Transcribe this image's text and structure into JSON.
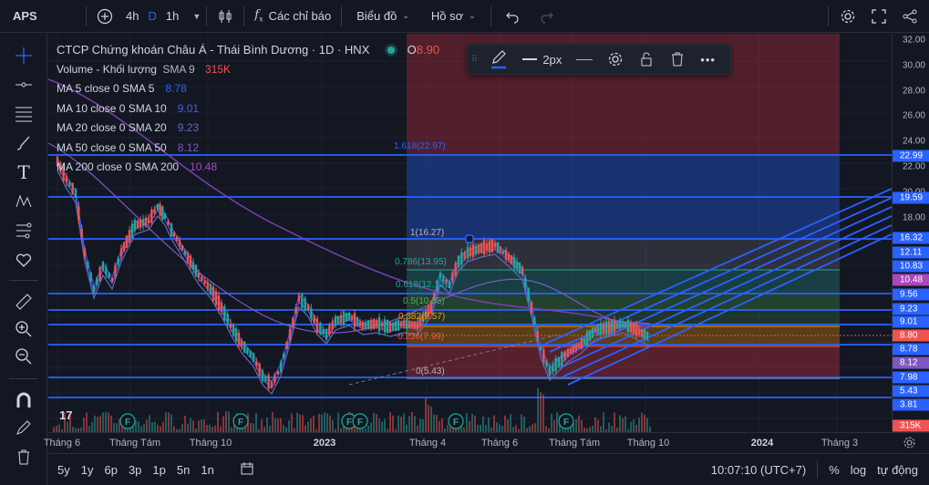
{
  "topbar": {
    "symbol": "APS",
    "timeframes": [
      "4h",
      "D",
      "1h"
    ],
    "active_timeframe": "D",
    "indicators_label": "Các chỉ báo",
    "chart_label": "Biểu đồ",
    "profile_label": "Hồ sơ"
  },
  "legend": {
    "title": "CTCP Chứng khoán Châu Á - Thái Bình Dương · 1D · HNX",
    "open_label": "O",
    "open_value": "8.90",
    "volume": {
      "label": "Volume - Khối lượng",
      "param": "SMA 9",
      "value": "315K",
      "color": "#ef5350"
    },
    "mas": [
      {
        "label": "MA 5 close 0 SMA 5",
        "value": "8.78",
        "color": "#2962ff"
      },
      {
        "label": "MA 10 close 0 SMA 10",
        "value": "9.01",
        "color": "#3d5afe"
      },
      {
        "label": "MA 20 close 0 SMA 20",
        "value": "9.23",
        "color": "#5c6bc0"
      },
      {
        "label": "MA 50 close 0 SMA 50",
        "value": "8.12",
        "color": "#7e57c2"
      },
      {
        "label": "MA 200 close 0 SMA 200",
        "value": "10.48",
        "color": "#ab47bc"
      }
    ]
  },
  "fib": [
    {
      "label": "1.618(22.97)",
      "color": "#2962ff"
    },
    {
      "label": "1(16.27)",
      "color": "#b2b5be"
    },
    {
      "label": "0.786(13.95)",
      "color": "#26a69a"
    },
    {
      "label": "0.618(12.13)",
      "color": "#26a69a"
    },
    {
      "label": "0.5(10.85)",
      "color": "#4caf50"
    },
    {
      "label": "0.382(9.57)",
      "color": "#ff9800"
    },
    {
      "label": "0.236(7.99)",
      "color": "#ef5350"
    },
    {
      "label": "0(5.43)",
      "color": "#b2b5be"
    }
  ],
  "draw_toolbar": {
    "width_label": "2px"
  },
  "price_axis": {
    "ticks": [
      "32.00",
      "30.00",
      "28.00",
      "26.00",
      "24.00",
      "22.00",
      "20.00",
      "18.00"
    ],
    "labels": [
      {
        "text": "22.99",
        "color": "#2962ff"
      },
      {
        "text": "19.59",
        "color": "#2962ff"
      },
      {
        "text": "16.32",
        "color": "#2962ff"
      },
      {
        "text": "12.11",
        "color": "#2962ff"
      },
      {
        "text": "10.83",
        "color": "#2962ff"
      },
      {
        "text": "10.48",
        "color": "#ab47bc"
      },
      {
        "text": "9.56",
        "color": "#2962ff"
      },
      {
        "text": "9.23",
        "color": "#2962ff"
      },
      {
        "text": "9.01",
        "color": "#2962ff"
      },
      {
        "text": "8.80",
        "color": "#ef5350"
      },
      {
        "text": "8.78",
        "color": "#2962ff"
      },
      {
        "text": "8.12",
        "color": "#7e57c2"
      },
      {
        "text": "7.98",
        "color": "#2962ff"
      },
      {
        "text": "5.43",
        "color": "#2962ff"
      },
      {
        "text": "3.81",
        "color": "#2962ff"
      },
      {
        "text": "315K",
        "color": "#ef5350"
      }
    ]
  },
  "time_axis": [
    "Tháng 6",
    "Tháng Tám",
    "Tháng 10",
    "2023",
    "Tháng 4",
    "Tháng 6",
    "Tháng Tám",
    "Tháng 10",
    "2024",
    "Tháng 3"
  ],
  "bottombar": {
    "ranges": [
      "5y",
      "1y",
      "6p",
      "3p",
      "1p",
      "5n",
      "1n"
    ],
    "time": "10:07:10 (UTC+7)",
    "percent": "%",
    "log": "log",
    "auto": "tự động"
  },
  "event_marker": "F"
}
